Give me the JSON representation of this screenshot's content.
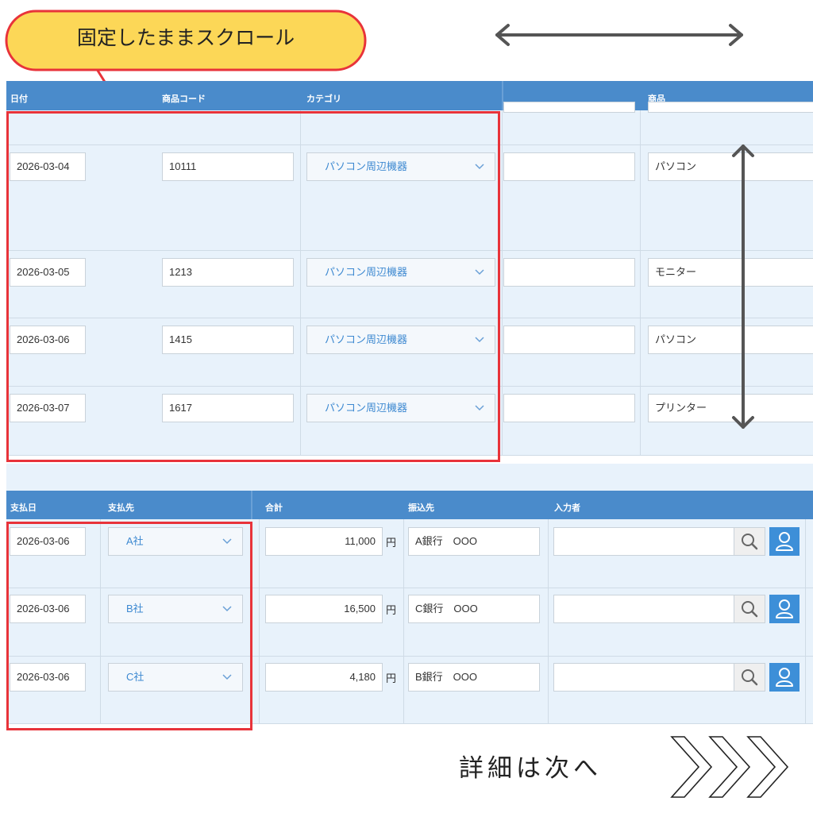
{
  "callout": {
    "text": "固定したままスクロール"
  },
  "footer": {
    "text": "詳細は次へ"
  },
  "table1": {
    "headers": [
      "日付",
      "商品コード",
      "カテゴリ",
      "商品"
    ],
    "rows": [
      {
        "date": "2026-03-04",
        "code": "10111",
        "category": "パソコン周辺機器",
        "product": "パソコン"
      },
      {
        "date": "2026-03-05",
        "code": "1213",
        "category": "パソコン周辺機器",
        "product": "モニター"
      },
      {
        "date": "2026-03-06",
        "code": "1415",
        "category": "パソコン周辺機器",
        "product": "パソコン"
      },
      {
        "date": "2026-03-07",
        "code": "1617",
        "category": "パソコン周辺機器",
        "product": "プリンター"
      }
    ]
  },
  "table2": {
    "headers": [
      "支払日",
      "支払先",
      "合計",
      "振込先",
      "入力者"
    ],
    "currency": "円",
    "rows": [
      {
        "date": "2026-03-06",
        "payee": "A社",
        "total": "11,000",
        "bank": "A銀行　OOO"
      },
      {
        "date": "2026-03-06",
        "payee": "B社",
        "total": "16,500",
        "bank": "C銀行　OOO"
      },
      {
        "date": "2026-03-06",
        "payee": "C社",
        "total": "4,180",
        "bank": "B銀行　OOO"
      }
    ]
  },
  "colors": {
    "header": "#4a8bcb",
    "highlight": "#e8333a",
    "callout_fill": "#fcd757",
    "select_text": "#3d89d1"
  }
}
